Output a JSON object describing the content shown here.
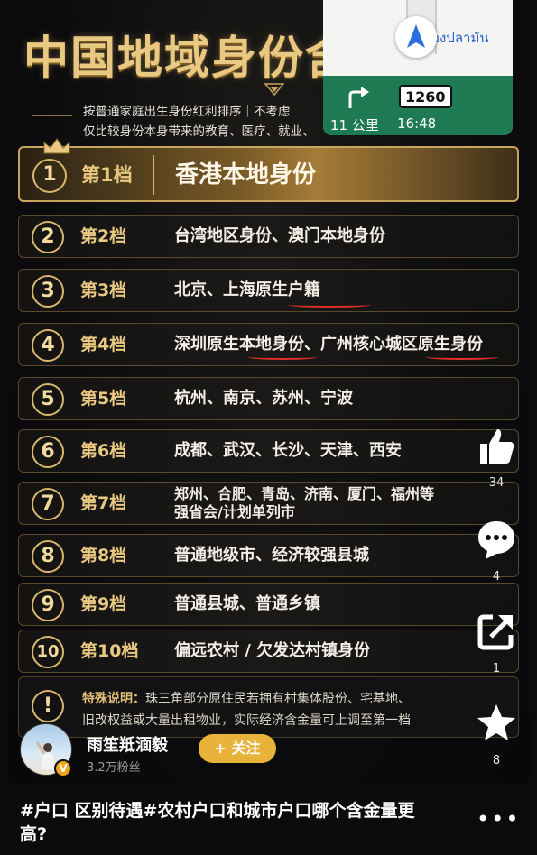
{
  "poster": {
    "title": "中国地域身份含",
    "subtitle_line1": "按普通家庭出生身份红利排序｜不考虑",
    "subtitle_line2": "仅比较身份本身带来的教育、医疗、就业、",
    "tiers": [
      {
        "num": "1",
        "rank": "第1档",
        "desc": "香港本地身份"
      },
      {
        "num": "2",
        "rank": "第2档",
        "desc": "台湾地区身份、澳门本地身份"
      },
      {
        "num": "3",
        "rank": "第3档",
        "desc": "北京、上海原生户籍"
      },
      {
        "num": "4",
        "rank": "第4档",
        "desc": "深圳原生本地身份、广州核心城区原生身份"
      },
      {
        "num": "5",
        "rank": "第5档",
        "desc": "杭州、南京、苏州、宁波"
      },
      {
        "num": "6",
        "rank": "第6档",
        "desc": "成都、武汉、长沙、天津、西安"
      },
      {
        "num": "7",
        "rank": "第7档",
        "desc_line1": "郑州、合肥、青岛、济南、厦门、福州等",
        "desc_line2": "强省会/计划单列市"
      },
      {
        "num": "8",
        "rank": "第8档",
        "desc": "普通地级市、经济较强县城"
      },
      {
        "num": "9",
        "rank": "第9档",
        "desc": "普通县城、普通乡镇"
      },
      {
        "num": "10",
        "rank": "第10档",
        "desc": "偏远农村 / 欠发达村镇身份"
      }
    ],
    "notice": {
      "icon": "!",
      "label": "特殊说明：",
      "line1": "珠三角部分原住民若拥有村集体股份、宅基地、",
      "line2": "旧改权益或大量出租物业，实际经济含金量可上调至第一档"
    }
  },
  "navigation": {
    "place_text": "องปลามัน",
    "distance": "11 公里",
    "time": "16:48",
    "road_number": "1260",
    "brand_color": "#1e7a52"
  },
  "side_actions": {
    "like_count": "34",
    "comment_count": "4",
    "share_count": "1",
    "favorite_count": "8"
  },
  "author": {
    "name": "雨笙羝湎毅",
    "fans": "3.2万粉丝",
    "badge": "V",
    "follow_label": "+ 关注"
  },
  "caption": {
    "text": "#户口 区别待遇#农村户口和城市户口哪个含金量更高?",
    "more": "•••"
  },
  "colors": {
    "gold": "#e9c982",
    "underline_red": "#e3312a"
  }
}
